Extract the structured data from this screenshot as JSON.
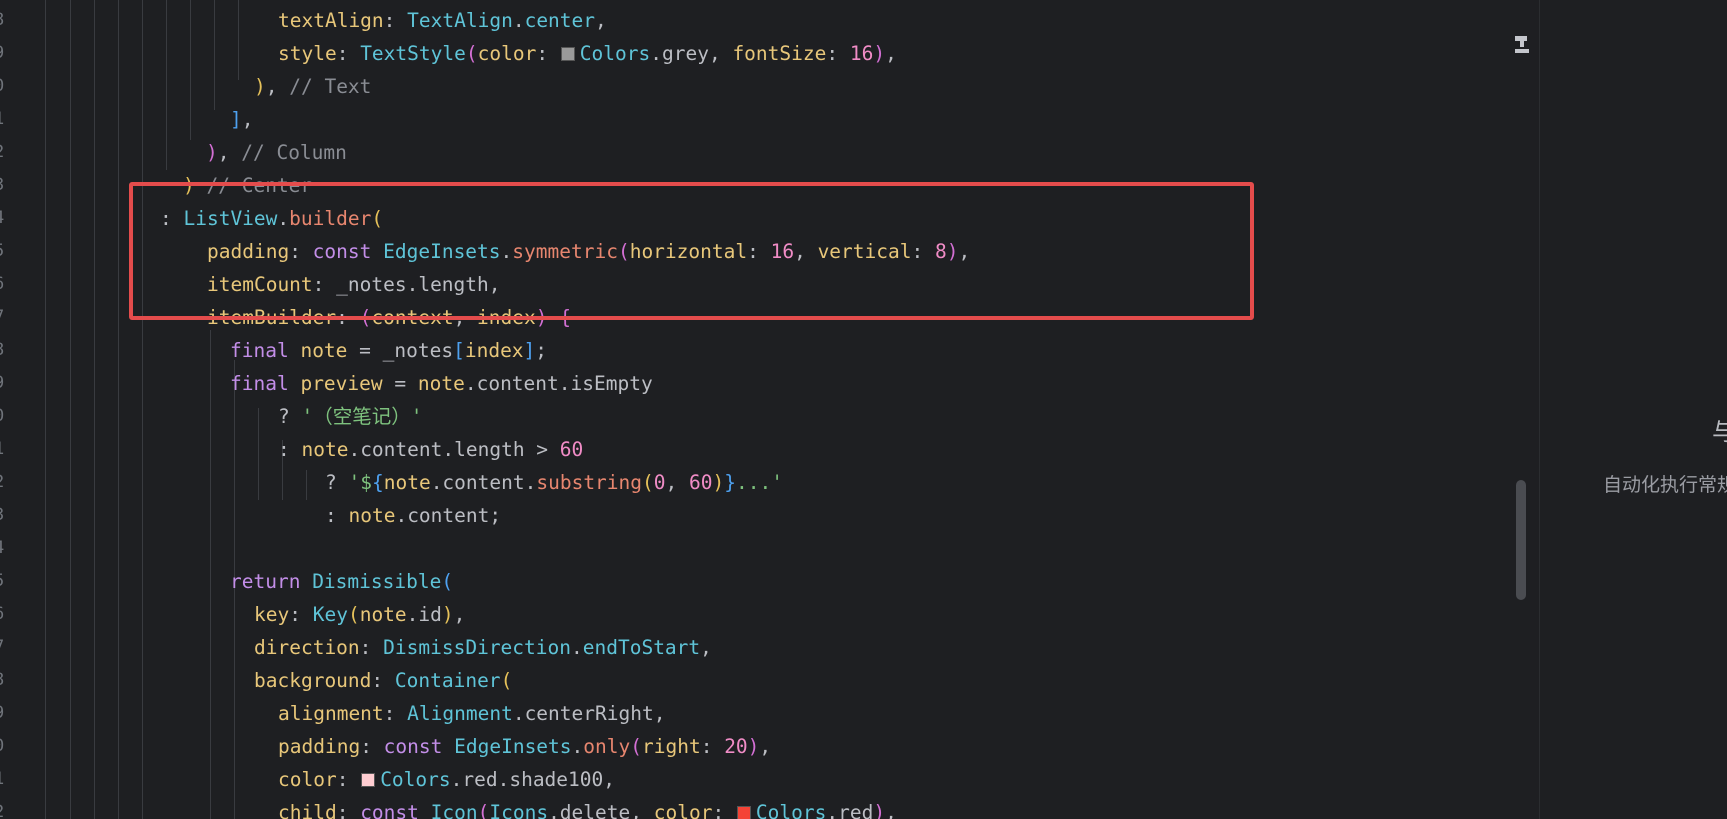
{
  "editor": {
    "line_numbers": [
      "8",
      "9",
      "0",
      "1",
      "2",
      "3",
      "4",
      "5",
      "6",
      "7",
      "8",
      "9",
      "0",
      "1",
      "2",
      "3",
      "4",
      "5",
      "6",
      "7",
      "8",
      "9",
      "0",
      "1",
      "2"
    ],
    "lines": [
      [
        {
          "t": "textAlign",
          "c": "prop"
        },
        {
          "t": ": ",
          "c": "plain"
        },
        {
          "t": "TextAlign",
          "c": "cls"
        },
        {
          "t": ".",
          "c": "plain"
        },
        {
          "t": "center",
          "c": "cls"
        },
        {
          "t": ",",
          "c": "plain"
        }
      ],
      [
        {
          "t": "style",
          "c": "prop"
        },
        {
          "t": ": ",
          "c": "plain"
        },
        {
          "t": "TextStyle",
          "c": "cls"
        },
        {
          "t": "(",
          "c": "p2"
        },
        {
          "t": "color",
          "c": "prop"
        },
        {
          "t": ": ",
          "c": "plain"
        },
        {
          "swatch": "#9a9a9a"
        },
        {
          "t": "Colors",
          "c": "cls"
        },
        {
          "t": ".grey, ",
          "c": "plain"
        },
        {
          "t": "fontSize",
          "c": "prop"
        },
        {
          "t": ": ",
          "c": "plain"
        },
        {
          "t": "16",
          "c": "num"
        },
        {
          "t": ")",
          "c": "p2"
        },
        {
          "t": ",",
          "c": "plain"
        }
      ],
      [
        {
          "t": ")",
          "c": "p1"
        },
        {
          "t": ", ",
          "c": "plain"
        },
        {
          "t": "// Text",
          "c": "cmt"
        }
      ],
      [
        {
          "t": "]",
          "c": "p3"
        },
        {
          "t": ",",
          "c": "plain"
        }
      ],
      [
        {
          "t": ")",
          "c": "p2"
        },
        {
          "t": ", ",
          "c": "plain"
        },
        {
          "t": "// Column",
          "c": "cmt"
        }
      ],
      [
        {
          "t": ")",
          "c": "p1"
        },
        {
          "t": " ",
          "c": "plain"
        },
        {
          "t": "// Center",
          "c": "cmt"
        }
      ],
      [
        {
          "t": ": ",
          "c": "plain"
        },
        {
          "t": "ListView",
          "c": "cls"
        },
        {
          "t": ".",
          "c": "plain"
        },
        {
          "t": "builder",
          "c": "meth"
        },
        {
          "t": "(",
          "c": "p1"
        }
      ],
      [
        {
          "t": "padding",
          "c": "prop"
        },
        {
          "t": ": ",
          "c": "plain"
        },
        {
          "t": "const ",
          "c": "kw"
        },
        {
          "t": "EdgeInsets",
          "c": "cls"
        },
        {
          "t": ".",
          "c": "plain"
        },
        {
          "t": "symmetric",
          "c": "meth"
        },
        {
          "t": "(",
          "c": "p2"
        },
        {
          "t": "horizontal",
          "c": "prop"
        },
        {
          "t": ": ",
          "c": "plain"
        },
        {
          "t": "16",
          "c": "num"
        },
        {
          "t": ", ",
          "c": "plain"
        },
        {
          "t": "vertical",
          "c": "prop"
        },
        {
          "t": ": ",
          "c": "plain"
        },
        {
          "t": "8",
          "c": "num"
        },
        {
          "t": ")",
          "c": "p2"
        },
        {
          "t": ",",
          "c": "plain"
        }
      ],
      [
        {
          "t": "itemCount",
          "c": "prop"
        },
        {
          "t": ": _notes.length,",
          "c": "plain"
        }
      ],
      [
        {
          "t": "itemBuilder",
          "c": "prop"
        },
        {
          "t": ": ",
          "c": "plain"
        },
        {
          "t": "(",
          "c": "p2"
        },
        {
          "t": "context",
          "c": "prop"
        },
        {
          "t": ", ",
          "c": "plain"
        },
        {
          "t": "index",
          "c": "prop"
        },
        {
          "t": ")",
          "c": "p2"
        },
        {
          "t": " ",
          "c": "plain"
        },
        {
          "t": "{",
          "c": "p2"
        }
      ],
      [
        {
          "t": "final ",
          "c": "kw"
        },
        {
          "t": "note",
          "c": "prop"
        },
        {
          "t": " = _notes",
          "c": "plain"
        },
        {
          "t": "[",
          "c": "p3"
        },
        {
          "t": "index",
          "c": "prop"
        },
        {
          "t": "]",
          "c": "p3"
        },
        {
          "t": ";",
          "c": "plain"
        }
      ],
      [
        {
          "t": "final ",
          "c": "kw"
        },
        {
          "t": "preview",
          "c": "prop"
        },
        {
          "t": " = ",
          "c": "plain"
        },
        {
          "t": "note",
          "c": "prop"
        },
        {
          "t": ".content.isEmpty",
          "c": "plain"
        }
      ],
      [
        {
          "t": "? ",
          "c": "plain"
        },
        {
          "t": "'（空笔记）'",
          "c": "str"
        }
      ],
      [
        {
          "t": ": ",
          "c": "plain"
        },
        {
          "t": "note",
          "c": "prop"
        },
        {
          "t": ".content.length > ",
          "c": "plain"
        },
        {
          "t": "60",
          "c": "num"
        }
      ],
      [
        {
          "t": "? ",
          "c": "plain"
        },
        {
          "t": "'$",
          "c": "str"
        },
        {
          "t": "{",
          "c": "p3"
        },
        {
          "t": "note",
          "c": "prop"
        },
        {
          "t": ".content.",
          "c": "plain"
        },
        {
          "t": "substring",
          "c": "meth"
        },
        {
          "t": "(",
          "c": "p1"
        },
        {
          "t": "0",
          "c": "num"
        },
        {
          "t": ", ",
          "c": "plain"
        },
        {
          "t": "60",
          "c": "num"
        },
        {
          "t": ")",
          "c": "p1"
        },
        {
          "t": "}",
          "c": "p3"
        },
        {
          "t": "...'",
          "c": "str"
        }
      ],
      [
        {
          "t": ": ",
          "c": "plain"
        },
        {
          "t": "note",
          "c": "prop"
        },
        {
          "t": ".content;",
          "c": "plain"
        }
      ],
      [],
      [
        {
          "t": "return ",
          "c": "kw"
        },
        {
          "t": "Dismissible",
          "c": "cls"
        },
        {
          "t": "(",
          "c": "p3"
        }
      ],
      [
        {
          "t": "key",
          "c": "prop"
        },
        {
          "t": ": ",
          "c": "plain"
        },
        {
          "t": "Key",
          "c": "cls"
        },
        {
          "t": "(",
          "c": "p1"
        },
        {
          "t": "note",
          "c": "prop"
        },
        {
          "t": ".id",
          "c": "plain"
        },
        {
          "t": ")",
          "c": "p1"
        },
        {
          "t": ",",
          "c": "plain"
        }
      ],
      [
        {
          "t": "direction",
          "c": "prop"
        },
        {
          "t": ": ",
          "c": "plain"
        },
        {
          "t": "DismissDirection",
          "c": "cls"
        },
        {
          "t": ".",
          "c": "plain"
        },
        {
          "t": "endToStart",
          "c": "cls"
        },
        {
          "t": ",",
          "c": "plain"
        }
      ],
      [
        {
          "t": "background",
          "c": "prop"
        },
        {
          "t": ": ",
          "c": "plain"
        },
        {
          "t": "Container",
          "c": "cls"
        },
        {
          "t": "(",
          "c": "p1"
        }
      ],
      [
        {
          "t": "alignment",
          "c": "prop"
        },
        {
          "t": ": ",
          "c": "plain"
        },
        {
          "t": "Alignment",
          "c": "cls"
        },
        {
          "t": ".centerRight,",
          "c": "plain"
        }
      ],
      [
        {
          "t": "padding",
          "c": "prop"
        },
        {
          "t": ": ",
          "c": "plain"
        },
        {
          "t": "const ",
          "c": "kw"
        },
        {
          "t": "EdgeInsets",
          "c": "cls"
        },
        {
          "t": ".",
          "c": "plain"
        },
        {
          "t": "only",
          "c": "meth"
        },
        {
          "t": "(",
          "c": "p2"
        },
        {
          "t": "right",
          "c": "prop"
        },
        {
          "t": ": ",
          "c": "plain"
        },
        {
          "t": "20",
          "c": "num"
        },
        {
          "t": ")",
          "c": "p2"
        },
        {
          "t": ",",
          "c": "plain"
        }
      ],
      [
        {
          "t": "color",
          "c": "prop"
        },
        {
          "t": ": ",
          "c": "plain"
        },
        {
          "swatch": "#ffcdd2"
        },
        {
          "t": "Colors",
          "c": "cls"
        },
        {
          "t": ".red.shade100,",
          "c": "plain"
        }
      ],
      [
        {
          "t": "child",
          "c": "prop"
        },
        {
          "t": ": ",
          "c": "plain"
        },
        {
          "t": "const ",
          "c": "kw"
        },
        {
          "t": "Icon",
          "c": "cls"
        },
        {
          "t": "(",
          "c": "p2"
        },
        {
          "t": "Icons",
          "c": "cls"
        },
        {
          "t": ".delete, ",
          "c": "plain"
        },
        {
          "t": "color",
          "c": "prop"
        },
        {
          "t": ": ",
          "c": "plain"
        },
        {
          "swatch": "#f44336"
        },
        {
          "t": "Colors",
          "c": "cls"
        },
        {
          "t": ".red",
          "c": "plain"
        },
        {
          "t": ")",
          "c": "p2"
        },
        {
          "t": ",",
          "c": "plain"
        }
      ]
    ]
  },
  "side_panel": {
    "letter": "与",
    "text": "自动化执行常规"
  },
  "colors": {
    "background": "#1e1f22",
    "highlight_border": "#e44c4c"
  }
}
